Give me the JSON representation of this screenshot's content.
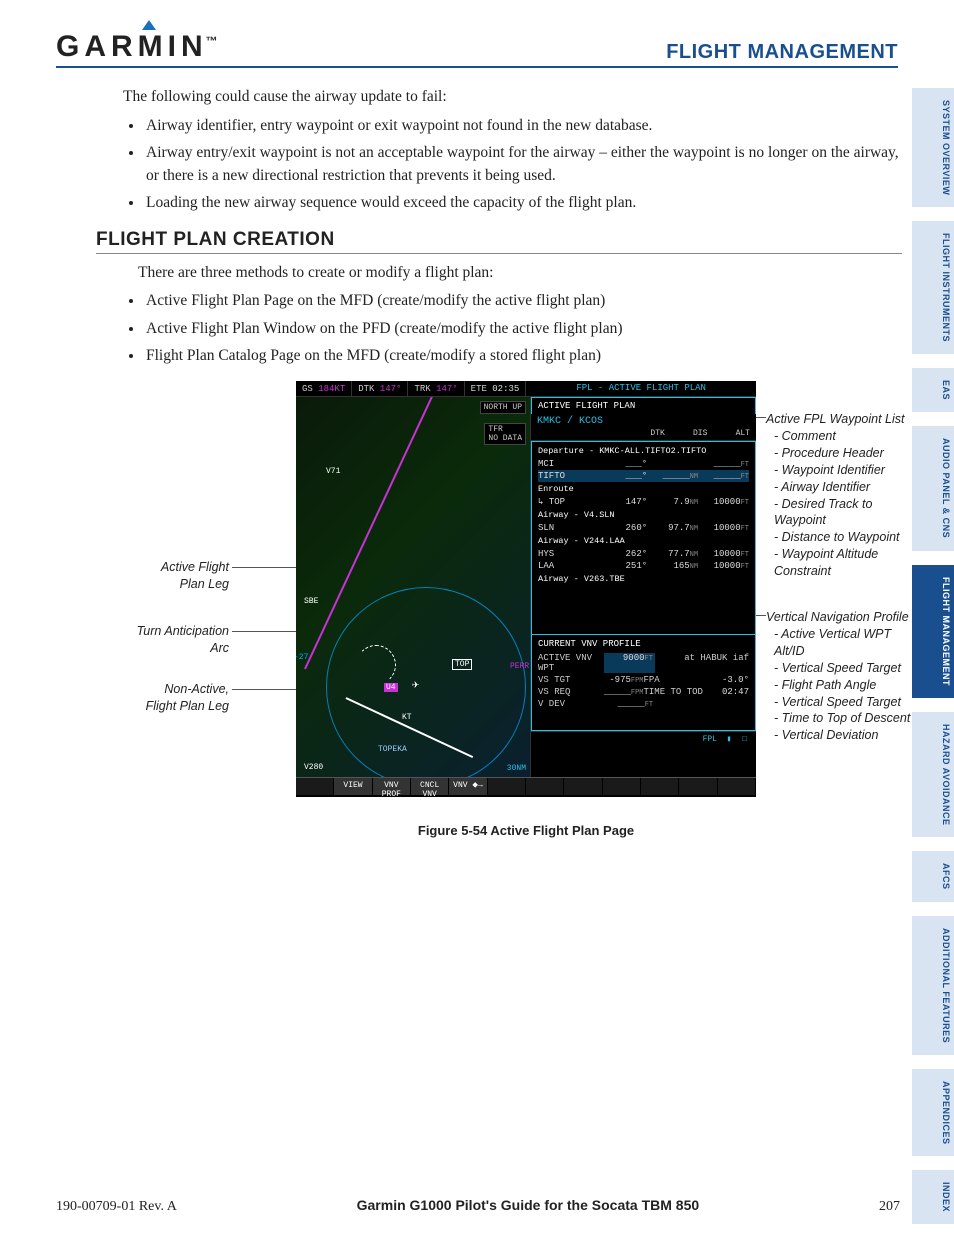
{
  "header": {
    "logo_text": "GARMIN",
    "logo_tm": "™",
    "section": "FLIGHT MANAGEMENT"
  },
  "intro_para": "The following could cause the airway update to fail:",
  "intro_bullets": [
    "Airway identifier, entry waypoint or exit waypoint not found in the new database.",
    "Airway entry/exit waypoint is not an acceptable waypoint for the airway – either the waypoint is no longer on the airway, or there is a new directional restriction that prevents it being used.",
    "Loading the new airway sequence would exceed the capacity of the flight plan."
  ],
  "subhead": "FLIGHT PLAN CREATION",
  "sub_para": "There are three methods to create or modify a flight plan:",
  "sub_bullets": [
    "Active Flight Plan Page on the MFD (create/modify the active flight plan)",
    "Active Flight Plan Window on the PFD (create/modify the active flight plan)",
    "Flight Plan Catalog Page on the MFD (create/modify a stored flight plan)"
  ],
  "figure": {
    "caption": "Figure 5-54  Active Flight Plan Page",
    "left_callouts": {
      "afpl": "Active Flight\nPlan Leg",
      "turn": "Turn Anticipation\nArc",
      "nonactive": "Non-Active,\nFlight Plan Leg"
    },
    "right_callouts": {
      "wpl_title": "Active FPL Waypoint List",
      "wpl_items": [
        "- Comment",
        "- Procedure Header",
        "- Waypoint Identifier",
        "- Airway Identifier",
        "- Desired Track to Waypoint",
        "- Distance to Waypoint",
        "- Waypoint Altitude Constraint"
      ],
      "vnv_title": "Vertical Navigation Profile",
      "vnv_items": [
        "- Active Vertical WPT Alt/ID",
        "- Vertical Speed Target",
        "- Flight Path Angle",
        "- Vertical Speed Target",
        "- Time to Top of Descent",
        "- Vertical Deviation"
      ]
    }
  },
  "mfd": {
    "top": {
      "gs_label": "GS",
      "gs_val": "184KT",
      "dtk_label": "DTK",
      "dtk_val": "147°",
      "trk_label": "TRK",
      "trk_val": "147°",
      "ete_label": "ETE",
      "ete_val": "02:35",
      "page_title": "FPL - ACTIVE FLIGHT PLAN"
    },
    "map": {
      "north_up": "NORTH UP",
      "tfr": "TFR",
      "no_data": "NO DATA",
      "v71": "V71",
      "sbe": "SBE",
      "u4": "U4",
      "topeka": "TOPEKA",
      "v280": "V280",
      "top": "TOP",
      "kt": "KT",
      "scale": "30NM",
      "num27": "-27"
    },
    "fpl": {
      "panel_title": "ACTIVE FLIGHT PLAN",
      "route": "KMKC / KCOS",
      "cols": [
        "",
        "DTK",
        "DIS",
        "ALT"
      ],
      "dep_hdr": "Departure - KMKC-ALL.TIFTO2.TIFTO",
      "rows": [
        {
          "id": "MCI",
          "dtk": "___°",
          "dis": "_____",
          "disu": "",
          "alt": "_____",
          "altu": "FT"
        },
        {
          "id": "TIFTO",
          "dtk": "___°",
          "dis": "_____",
          "disu": "NM",
          "alt": "_____",
          "altu": "FT",
          "hl": true
        }
      ],
      "enr_hdr": "Enroute",
      "enr_rows": [
        {
          "id": "TOP",
          "dtk": "147°",
          "dis": "7.9",
          "disu": "NM",
          "alt": "10000",
          "altu": "FT",
          "pre": "↳"
        }
      ],
      "awy1": "Airway - V4.SLN",
      "awy1_rows": [
        {
          "id": "SLN",
          "dtk": "260°",
          "dis": "97.7",
          "disu": "NM",
          "alt": "10000",
          "altu": "FT"
        }
      ],
      "awy2": "Airway - V244.LAA",
      "awy2_rows": [
        {
          "id": "HYS",
          "dtk": "262°",
          "dis": "77.7",
          "disu": "NM",
          "alt": "10000",
          "altu": "FT"
        },
        {
          "id": "LAA",
          "dtk": "251°",
          "dis": "165",
          "disu": "NM",
          "alt": "10000",
          "altu": "FT"
        }
      ],
      "awy3": "Airway - V263.TBE"
    },
    "vnv": {
      "title": "CURRENT VNV PROFILE",
      "perr": "PERR",
      "r1": {
        "lab": "ACTIVE VNV WPT",
        "val": "9000",
        "u": "FT",
        "extra": "at  HABUK iaf"
      },
      "r2": {
        "lab": "VS TGT",
        "val": "-975",
        "u": "FPM",
        "lab2": "FPA",
        "val2": "-3.0°"
      },
      "r3": {
        "lab": "VS REQ",
        "val": "_____",
        "u": "FPM",
        "lab2": "TIME TO TOD",
        "val2": "02:47"
      },
      "r4": {
        "lab": "V DEV",
        "val": "_____",
        "u": "FT"
      }
    },
    "page_ind": {
      "grp": "FPL",
      "boxes": "▮ □"
    },
    "softkeys": [
      "",
      "VIEW",
      "VNV PROF",
      "CNCL VNV",
      "VNV ⬥→",
      "",
      "",
      "",
      "",
      "",
      "",
      ""
    ]
  },
  "side_tabs": [
    "SYSTEM OVERVIEW",
    "FLIGHT INSTRUMENTS",
    "EAS",
    "AUDIO PANEL & CNS",
    "FLIGHT MANAGEMENT",
    "HAZARD AVOIDANCE",
    "AFCS",
    "ADDITIONAL FEATURES",
    "APPENDICES",
    "INDEX"
  ],
  "active_tab_index": 4,
  "footer": {
    "doc": "190-00709-01  Rev. A",
    "title": "Garmin G1000 Pilot's Guide for the Socata TBM 850",
    "page": "207"
  }
}
